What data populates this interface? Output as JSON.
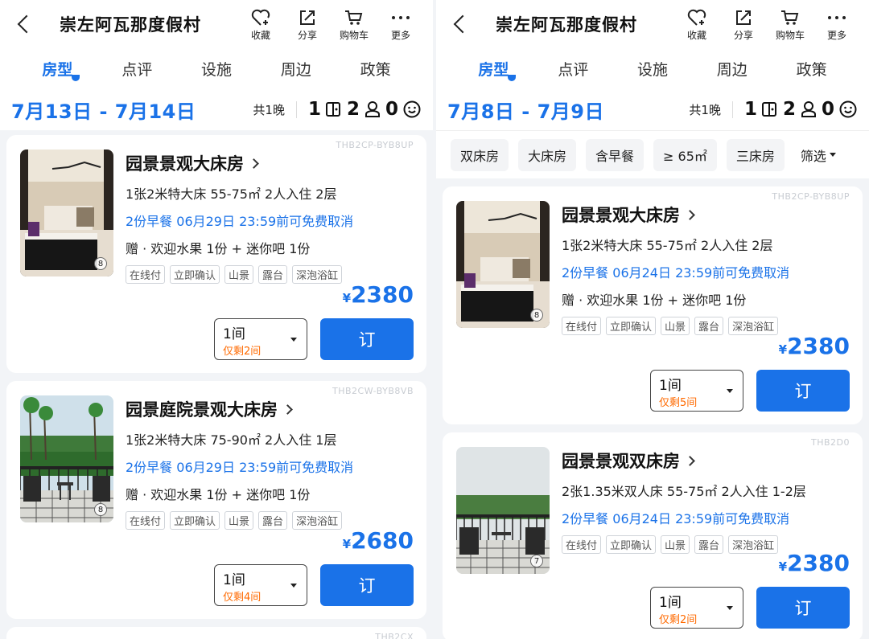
{
  "hotel_title": "崇左阿瓦那度假村",
  "actions": [
    {
      "label": "收藏",
      "icon": "heart-plus-icon"
    },
    {
      "label": "分享",
      "icon": "share-icon"
    },
    {
      "label": "购物车",
      "icon": "cart-icon"
    },
    {
      "label": "更多",
      "icon": "more-icon"
    }
  ],
  "tabs": [
    "房型",
    "点评",
    "设施",
    "周边",
    "政策"
  ],
  "accent": "#1a72e8",
  "left": {
    "date_range": "7月13日 - 7月14日",
    "nights": "共1晚",
    "rooms": "1",
    "adults": "2",
    "children": "0",
    "cards": [
      {
        "code": "THB2CP-BYB8UP",
        "name": "园景景观大床房",
        "bed": "1张2米特大床 55-75㎡ 2人入住 2层",
        "breakfast": "2份早餐 06月29日 23:59前可免费取消",
        "gift": "赠 · 欢迎水果 1份 + 迷你吧 1份",
        "tags": [
          "在线付",
          "立即确认",
          "山景",
          "露台",
          "深泡浴缸"
        ],
        "photo_count": "8",
        "price_currency": "¥",
        "price": "2380",
        "qty": "1间",
        "remaining": "仅剩2间",
        "book": "订"
      },
      {
        "code": "THB2CW-BYB8VB",
        "name": "园景庭院景观大床房",
        "bed": "1张2米特大床 75-90㎡ 2人入住 1层",
        "breakfast": "2份早餐 06月29日 23:59前可免费取消",
        "gift": "赠 · 欢迎水果 1份 + 迷你吧 1份",
        "tags": [
          "在线付",
          "立即确认",
          "山景",
          "露台",
          "深泡浴缸"
        ],
        "photo_count": "8",
        "price_currency": "¥",
        "price": "2680",
        "qty": "1间",
        "remaining": "仅剩4间",
        "book": "订"
      }
    ],
    "stub_code": "THB2CX"
  },
  "right": {
    "date_range": "7月8日 - 7月9日",
    "nights": "共1晚",
    "rooms": "1",
    "adults": "2",
    "children": "0",
    "filters": [
      "双床房",
      "大床房",
      "含早餐",
      "≥ 65㎡",
      "三床房"
    ],
    "filter_select": "筛选",
    "cards": [
      {
        "code": "THB2CP-BYB8UP",
        "name": "园景景观大床房",
        "bed": "1张2米特大床 55-75㎡ 2人入住 2层",
        "breakfast": "2份早餐 06月24日 23:59前可免费取消",
        "gift": "赠 · 欢迎水果 1份 + 迷你吧 1份",
        "tags": [
          "在线付",
          "立即确认",
          "山景",
          "露台",
          "深泡浴缸"
        ],
        "photo_count": "8",
        "price_currency": "¥",
        "price": "2380",
        "qty": "1间",
        "remaining": "仅剩5间",
        "book": "订"
      },
      {
        "code": "THB2D0",
        "name": "园景景观双床房",
        "bed": "2张1.35米双人床 55-75㎡ 2人入住 1-2层",
        "breakfast": "2份早餐 06月24日 23:59前可免费取消",
        "tags": [
          "在线付",
          "立即确认",
          "山景",
          "露台",
          "深泡浴缸"
        ],
        "photo_count": "7",
        "price_currency": "¥",
        "price": "2380",
        "qty": "1间",
        "remaining": "仅剩2间",
        "book": "订"
      }
    ]
  }
}
